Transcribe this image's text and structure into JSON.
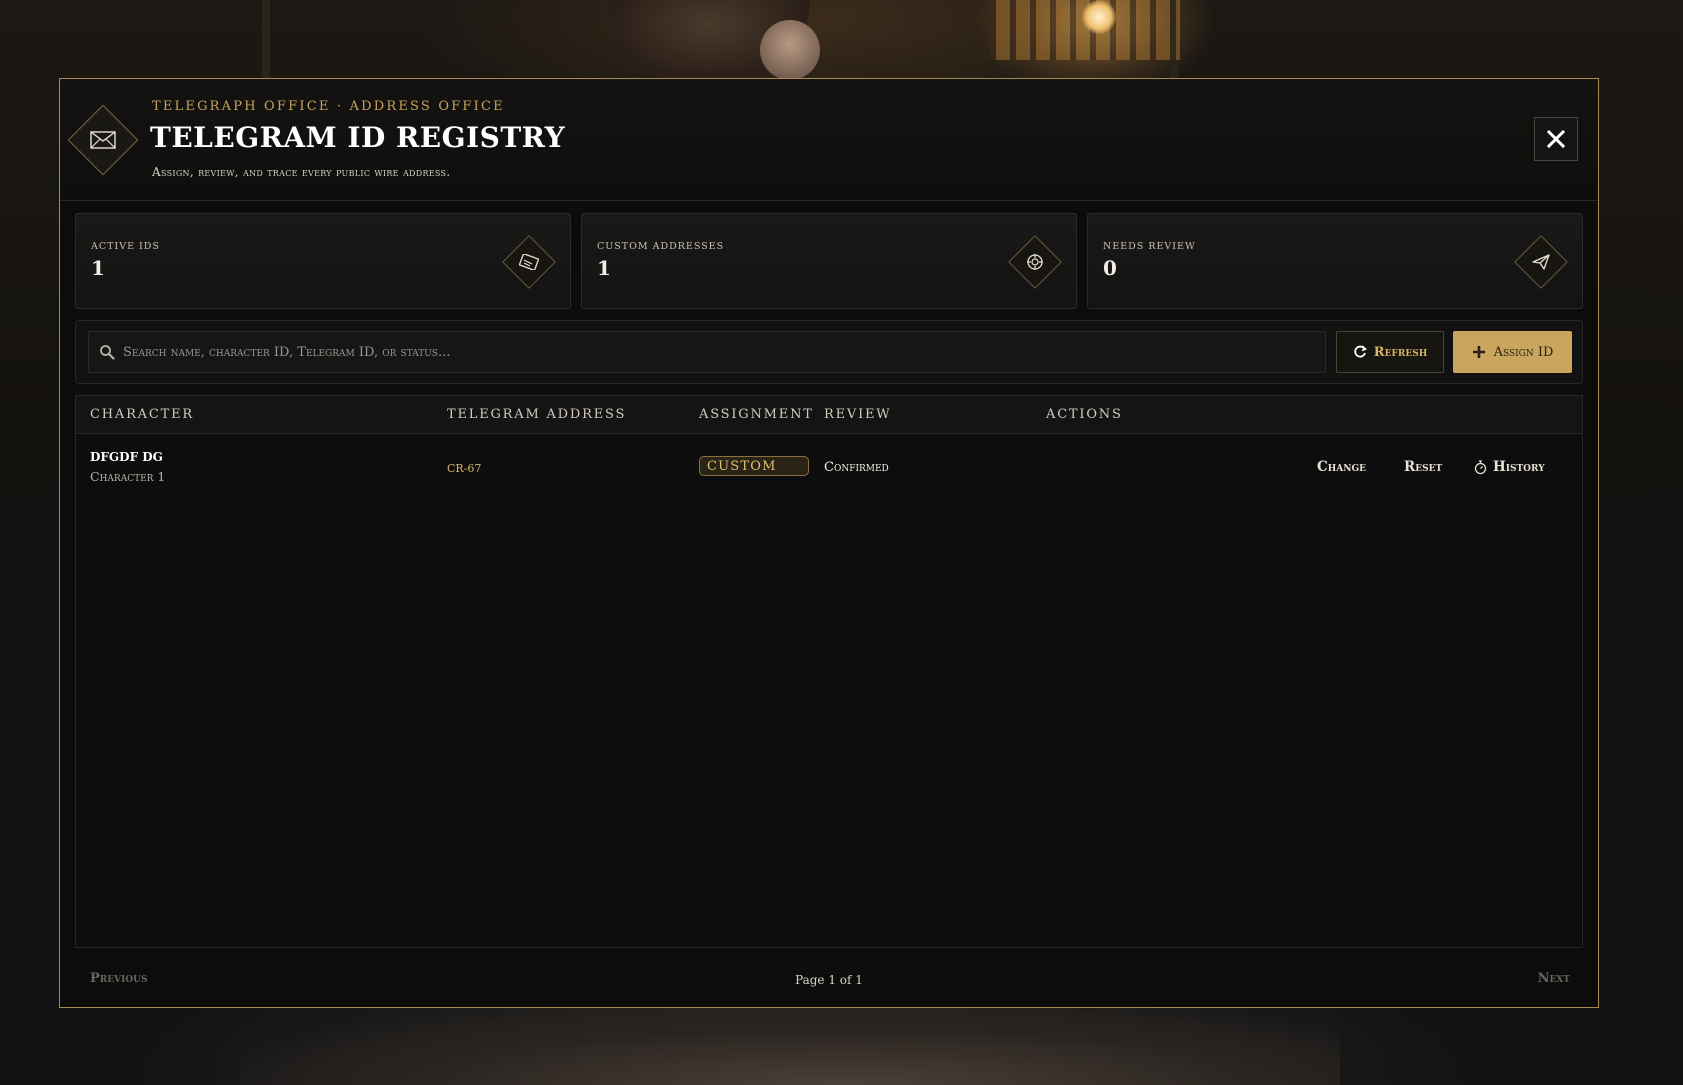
{
  "header": {
    "eyebrow": "Telegraph Office · Address Office",
    "title": "Telegram ID Registry",
    "subtitle": "Assign, review, and trace every public wire address.",
    "logo_icon": "envelope-icon",
    "close_icon": "close-icon"
  },
  "stats": [
    {
      "label": "Active IDs",
      "value": "1",
      "icon": "telegram-card-icon"
    },
    {
      "label": "Custom Addresses",
      "value": "1",
      "icon": "seal-icon"
    },
    {
      "label": "Needs Review",
      "value": "0",
      "icon": "paper-plane-icon"
    }
  ],
  "toolbar": {
    "search_placeholder": "Search name, character ID, Telegram ID, or status...",
    "search_value": "",
    "refresh_label": "Refresh",
    "assign_label": "Assign ID"
  },
  "table": {
    "columns": [
      "Character",
      "Telegram Address",
      "Assignment",
      "Review",
      "Actions"
    ],
    "rows": [
      {
        "name": "dfgdf dg",
        "character": "Character 1",
        "address": "CR-67",
        "assignment": "Custom",
        "review": "Confirmed",
        "actions": {
          "change": "Change",
          "reset": "Reset",
          "history": "History"
        }
      }
    ]
  },
  "pagination": {
    "previous": "Previous",
    "page_text": "Page 1 of 1",
    "next": "Next"
  },
  "colors": {
    "accent_gold": "#c9a55d",
    "border_gold": "#a98c52",
    "panel": "#0c0c0c"
  }
}
